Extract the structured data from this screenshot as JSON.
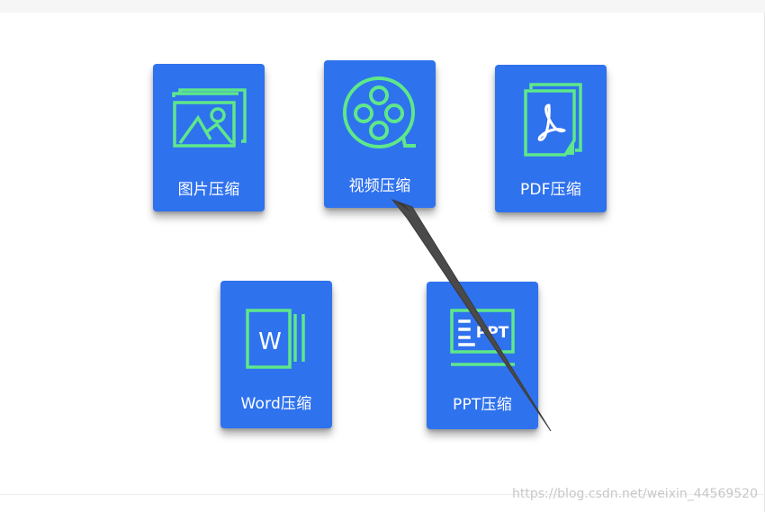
{
  "tiles": [
    {
      "id": "image",
      "label": "图片压缩",
      "icon": "image-icon"
    },
    {
      "id": "video",
      "label": "视频压缩",
      "icon": "film-reel-icon"
    },
    {
      "id": "pdf",
      "label": "PDF压缩",
      "icon": "pdf-file-icon"
    },
    {
      "id": "word",
      "label": "Word压缩",
      "icon": "word-file-icon"
    },
    {
      "id": "ppt",
      "label": "PPT压缩",
      "icon": "ppt-file-icon"
    }
  ],
  "icon_texts": {
    "word_letter": "W",
    "ppt_text": "PPT"
  },
  "watermark": "https://blog.csdn.net/weixin_44569520",
  "colors": {
    "tile_bg": "#2f72ee",
    "icon_green": "#5ee88a",
    "arrow": "#4a4a4a"
  }
}
